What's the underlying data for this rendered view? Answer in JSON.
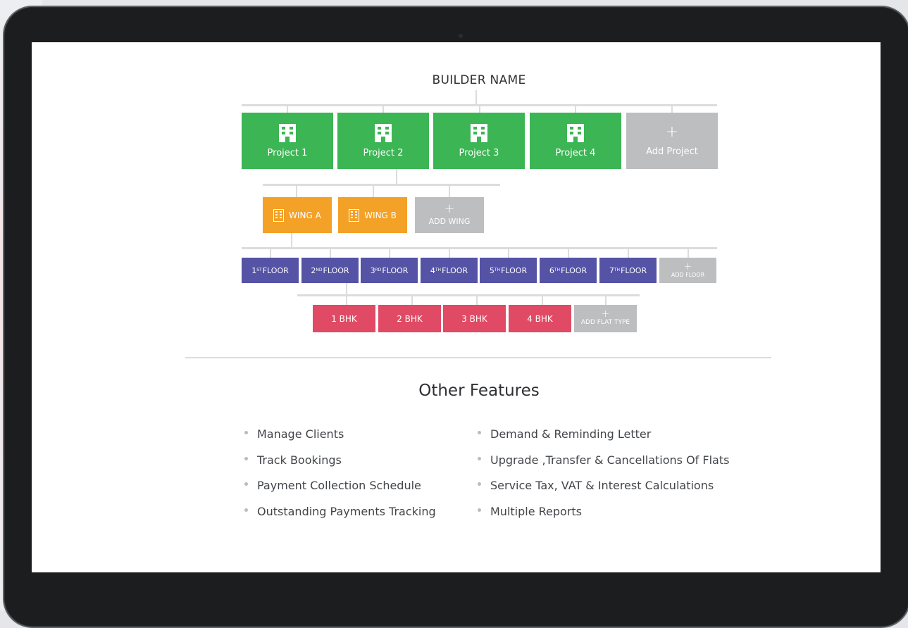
{
  "diagram": {
    "root": "BUILDER NAME",
    "projects": [
      {
        "label": "Project 1"
      },
      {
        "label": "Project 2"
      },
      {
        "label": "Project 3"
      },
      {
        "label": "Project 4"
      }
    ],
    "add_project": "Add Project",
    "wings": [
      {
        "label": "WING A"
      },
      {
        "label": "WING B"
      }
    ],
    "add_wing": "ADD WING",
    "floors": [
      {
        "num": "1",
        "suffix": "ST",
        "label": "FLOOR"
      },
      {
        "num": "2",
        "suffix": "ND",
        "label": "FLOOR"
      },
      {
        "num": "3",
        "suffix": "RD",
        "label": "FLOOR"
      },
      {
        "num": "4",
        "suffix": "TH",
        "label": "FLOOR"
      },
      {
        "num": "5",
        "suffix": "TH",
        "label": "FLOOR"
      },
      {
        "num": "6",
        "suffix": "TH",
        "label": "FLOOR"
      },
      {
        "num": "7",
        "suffix": "TH",
        "label": "FLOOR"
      }
    ],
    "add_floor": "ADD FLOOR",
    "flats": [
      {
        "label": "1 BHK"
      },
      {
        "label": "2 BHK"
      },
      {
        "label": "3 BHK"
      },
      {
        "label": "4 BHK"
      }
    ],
    "add_flat": "ADD FLAT TYPE",
    "plus": "+",
    "colors": {
      "project": "#3cb554",
      "wing": "#f3a127",
      "floor": "#5453a6",
      "flat": "#e04a64",
      "add": "#bdbebf",
      "connector": "#dcdcdc"
    }
  },
  "features": {
    "title": "Other Features",
    "left": [
      "Manage Clients",
      "Track Bookings",
      "Payment Collection Schedule",
      "Outstanding Payments Tracking"
    ],
    "right": [
      "Demand & Reminding Letter",
      "Upgrade ,Transfer & Cancellations Of Flats",
      "Service Tax, VAT & Interest Calculations",
      "Multiple Reports"
    ]
  },
  "icons": {
    "project": "building-icon",
    "wing": "building-icon",
    "add": "plus-icon",
    "bullet": "bullet-dot-icon"
  }
}
